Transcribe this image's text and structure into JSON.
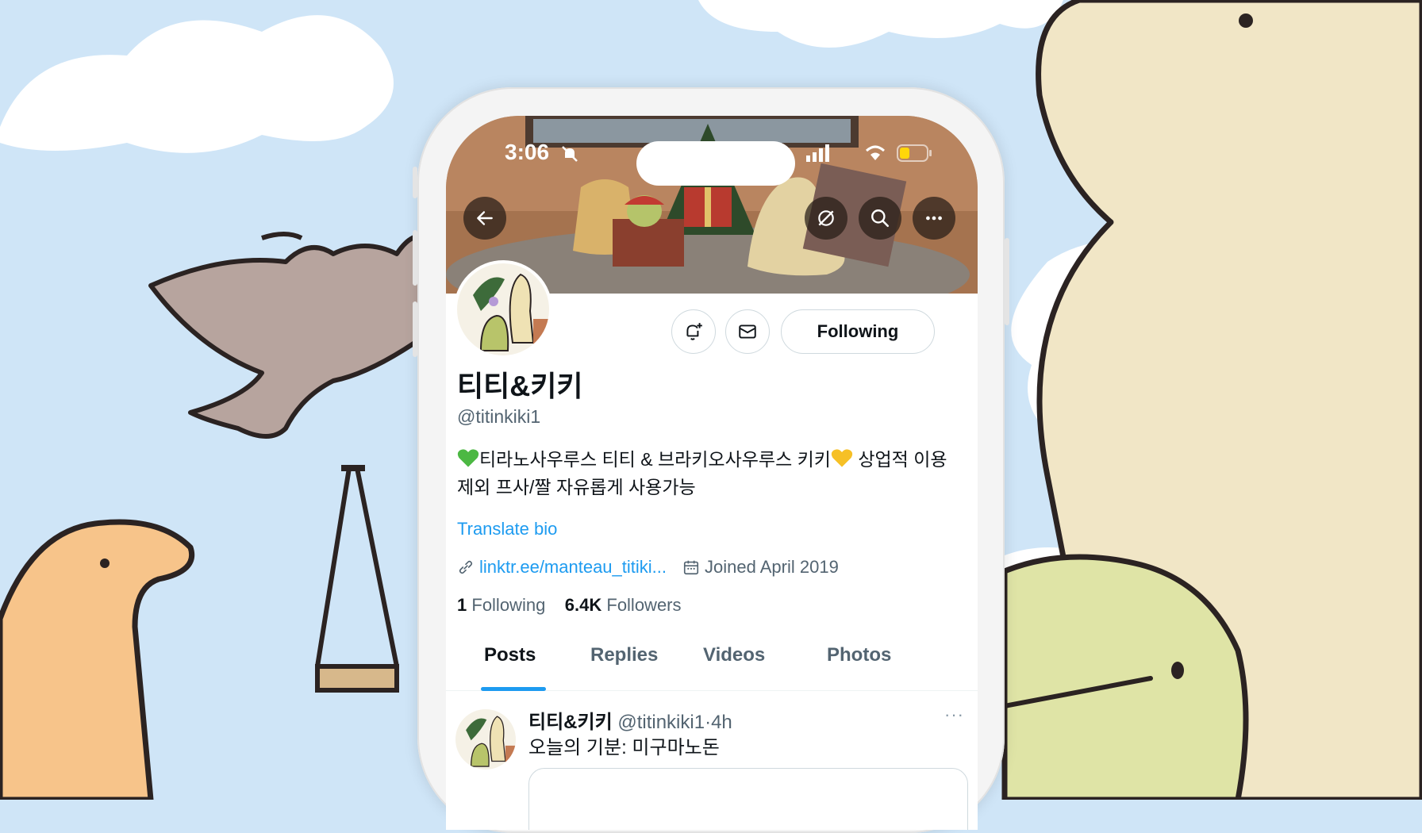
{
  "status": {
    "time": "3:06"
  },
  "profile": {
    "name": "티티&키키",
    "handle": "@titinkiki1",
    "bio_part1": "티라노사우루스 티티 & 브라키오사우루스 키키",
    "bio_part2": " 상업적 이용 제외 프사/짤 자유롭게 사용가능",
    "translate_label": "Translate bio",
    "link": "linktr.ee/manteau_titiki...",
    "joined": "Joined April 2019",
    "following_count": "1",
    "following_label": "Following",
    "followers_count": "6.4K",
    "followers_label": "Followers"
  },
  "actions": {
    "following_button": "Following"
  },
  "tabs": [
    {
      "label": "Posts",
      "active": true
    },
    {
      "label": "Replies",
      "active": false
    },
    {
      "label": "Videos",
      "active": false
    },
    {
      "label": "Photos",
      "active": false
    }
  ],
  "post": {
    "name": "티티&키키",
    "handle": "@titinkiki1",
    "separator": "·",
    "time": "4h",
    "text": "오늘의 기분: 미구마노돈",
    "more": "···"
  },
  "icons": {
    "back": "arrow-left-icon",
    "hide": "eye-slash-icon",
    "search": "search-icon",
    "more": "more-horizontal-icon",
    "notify": "bell-plus-icon",
    "message": "envelope-icon",
    "link": "link-icon",
    "calendar": "calendar-icon"
  },
  "colors": {
    "accent": "#1d9bf0",
    "text": "#0f1419",
    "muted": "#536471",
    "sky": "#cfe5f7"
  }
}
